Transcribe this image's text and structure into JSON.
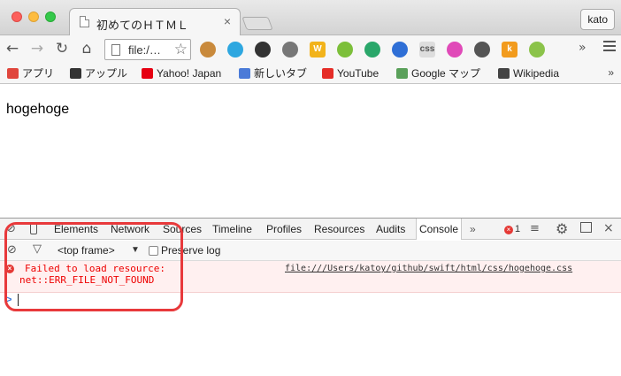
{
  "window": {
    "tab_title": "初めてのＨＴＭＬ",
    "tab_close": "×",
    "profile_name": "kato"
  },
  "toolbar": {
    "back": "←",
    "forward": "→",
    "reload": "↻",
    "home": "⌂",
    "address": "file:/…",
    "star": "☆",
    "extensions": [
      {
        "name": "cookie-extension-icon",
        "color": "#c98a3c",
        "glyph": ""
      },
      {
        "name": "twitter-extension-icon",
        "color": "#2ea7e0",
        "glyph": ""
      },
      {
        "name": "speedometer-extension-icon",
        "color": "#333333",
        "glyph": ""
      },
      {
        "name": "bug-extension-icon",
        "color": "#777777",
        "glyph": ""
      },
      {
        "name": "w-extension-icon",
        "color": "#f2b31b",
        "glyph": "W"
      },
      {
        "name": "green-circle-extension-icon",
        "color": "#7cbf3a",
        "glyph": ""
      },
      {
        "name": "sync-extension-icon",
        "color": "#2aa76a",
        "glyph": ""
      },
      {
        "name": "gear-extension-icon",
        "color": "#2f6fd6",
        "glyph": ""
      },
      {
        "name": "css-extension-icon",
        "color": "#dddddd",
        "glyph": "css"
      },
      {
        "name": "color-wheel-extension-icon",
        "color": "#e04ab8",
        "glyph": ""
      },
      {
        "name": "eyedropper-extension-icon",
        "color": "#555555",
        "glyph": ""
      },
      {
        "name": "k-extension-icon",
        "color": "#f29b1d",
        "glyph": "k"
      },
      {
        "name": "puzzle-extension-icon",
        "color": "#8bc34a",
        "glyph": ""
      }
    ],
    "overflow": "»"
  },
  "bookmarks": {
    "items": [
      {
        "label": "アプリ",
        "icon": "apps-grid-icon",
        "color": "#e0463d"
      },
      {
        "label": "アップル",
        "icon": "apple-icon",
        "color": "#333333"
      },
      {
        "label": "Yahoo! Japan",
        "icon": "yahoo-icon",
        "color": "#e60012"
      },
      {
        "label": "新しいタブ",
        "icon": "new-tab-icon",
        "color": "#4a7bd8"
      },
      {
        "label": "YouTube",
        "icon": "youtube-icon",
        "color": "#e52d27"
      },
      {
        "label": "Google マップ",
        "icon": "google-maps-icon",
        "color": "#5aa05a"
      },
      {
        "label": "Wikipedia",
        "icon": "wikipedia-icon",
        "color": "#444444"
      }
    ],
    "more": "»"
  },
  "page": {
    "text": "hogehoge"
  },
  "devtools": {
    "tabs": [
      "Elements",
      "Network",
      "Sources",
      "Timeline",
      "Profiles",
      "Resources",
      "Audits",
      "Console"
    ],
    "active_tab": "Console",
    "more_tabs": "»",
    "error_count": "1",
    "frame_select": "<top frame>",
    "frame_arrow": "▼",
    "preserve_log": "Preserve log",
    "console_message": {
      "line1": "Failed to load resource:",
      "line2": "net::ERR_FILE_NOT_FOUND",
      "source": "file:///Users/katoy/github/swift/html/css/hogehoge.css"
    },
    "prompt_caret": ">"
  },
  "colors": {
    "error_red": "#e00000",
    "annotation_red": "#e8393b"
  }
}
